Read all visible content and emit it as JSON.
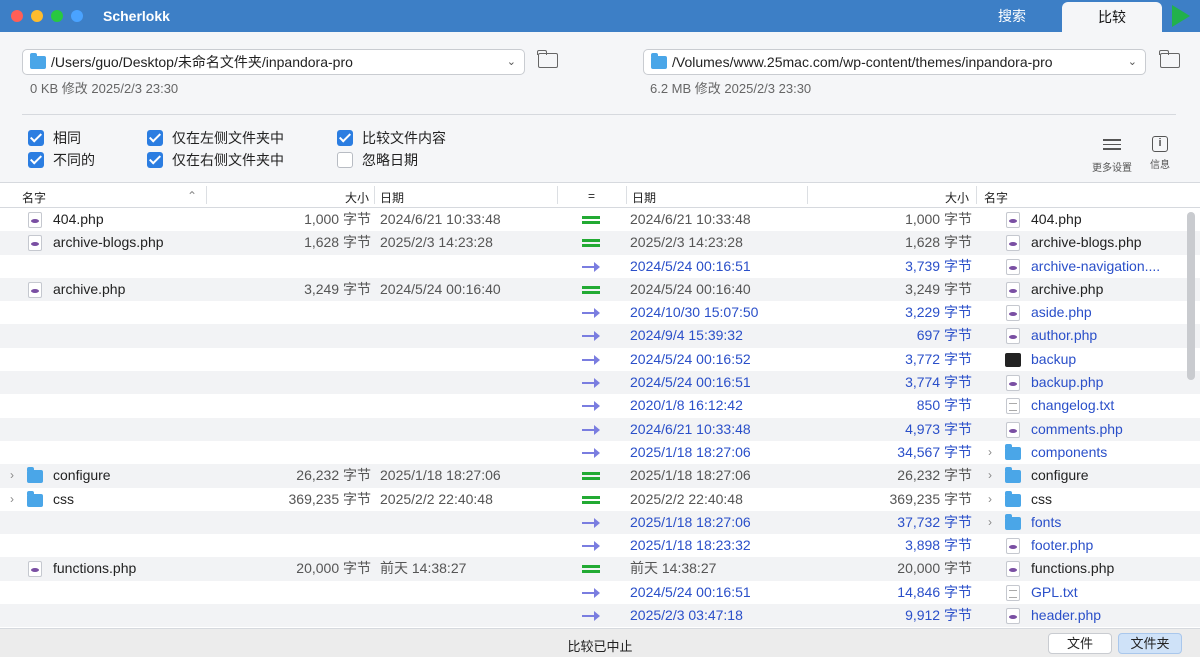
{
  "app_title": "Scherlokk",
  "tabs": [
    {
      "label": "搜索"
    },
    {
      "label": "比较"
    }
  ],
  "left": {
    "path": "/Users/guo/Desktop/未命名文件夹/inpandora-pro",
    "meta": "0 KB 修改 2025/2/3 23:30"
  },
  "right": {
    "path": "/Volumes/www.25mac.com/wp-content/themes/inpandora-pro",
    "meta": "6.2 MB 修改 2025/2/3 23:30"
  },
  "options": {
    "same": "相同",
    "different": "不同的",
    "only_left": "仅在左侧文件夹中",
    "only_right": "仅在右侧文件夹中",
    "compare_content": "比较文件内容",
    "ignore_date": "忽略日期"
  },
  "tools": {
    "more_settings": "更多设置",
    "info": "信息"
  },
  "columns": {
    "name": "名字",
    "size": "大小",
    "date": "日期",
    "compare": "="
  },
  "rows": [
    {
      "lname": "404.php",
      "lsize": "1,000 字节",
      "ldate": "2024/6/21 10:33:48",
      "rdate": "2024/6/21 10:33:48",
      "rsize": "1,000 字节",
      "rname": "404.php"
    },
    {
      "lname": "archive-blogs.php",
      "lsize": "1,628 字节",
      "ldate": "2025/2/3 14:23:28",
      "rdate": "2025/2/3 14:23:28",
      "rsize": "1,628 字节",
      "rname": "archive-blogs.php"
    },
    {
      "lname": "",
      "lsize": "",
      "ldate": "",
      "rdate": "2024/5/24 00:16:51",
      "rsize": "3,739 字节",
      "rname": "archive-navigation...."
    },
    {
      "lname": "archive.php",
      "lsize": "3,249 字节",
      "ldate": "2024/5/24 00:16:40",
      "rdate": "2024/5/24 00:16:40",
      "rsize": "3,249 字节",
      "rname": "archive.php"
    },
    {
      "lname": "",
      "lsize": "",
      "ldate": "",
      "rdate": "2024/10/30 15:07:50",
      "rsize": "3,229 字节",
      "rname": "aside.php"
    },
    {
      "lname": "",
      "lsize": "",
      "ldate": "",
      "rdate": "2024/9/4 15:39:32",
      "rsize": "697 字节",
      "rname": "author.php"
    },
    {
      "lname": "",
      "lsize": "",
      "ldate": "",
      "rdate": "2024/5/24 00:16:52",
      "rsize": "3,772 字节",
      "rname": "backup"
    },
    {
      "lname": "",
      "lsize": "",
      "ldate": "",
      "rdate": "2024/5/24 00:16:51",
      "rsize": "3,774 字节",
      "rname": "backup.php"
    },
    {
      "lname": "",
      "lsize": "",
      "ldate": "",
      "rdate": "2020/1/8 16:12:42",
      "rsize": "850 字节",
      "rname": "changelog.txt"
    },
    {
      "lname": "",
      "lsize": "",
      "ldate": "",
      "rdate": "2024/6/21 10:33:48",
      "rsize": "4,973 字节",
      "rname": "comments.php"
    },
    {
      "lname": "",
      "lsize": "",
      "ldate": "",
      "rdate": "2025/1/18 18:27:06",
      "rsize": "34,567 字节",
      "rname": "components"
    },
    {
      "lname": "configure",
      "lsize": "26,232 字节",
      "ldate": "2025/1/18 18:27:06",
      "rdate": "2025/1/18 18:27:06",
      "rsize": "26,232 字节",
      "rname": "configure"
    },
    {
      "lname": "css",
      "lsize": "369,235 字节",
      "ldate": "2025/2/2 22:40:48",
      "rdate": "2025/2/2 22:40:48",
      "rsize": "369,235 字节",
      "rname": "css"
    },
    {
      "lname": "",
      "lsize": "",
      "ldate": "",
      "rdate": "2025/1/18 18:27:06",
      "rsize": "37,732 字节",
      "rname": "fonts"
    },
    {
      "lname": "",
      "lsize": "",
      "ldate": "",
      "rdate": "2025/1/18 18:23:32",
      "rsize": "3,898 字节",
      "rname": "footer.php"
    },
    {
      "lname": "functions.php",
      "lsize": "20,000 字节",
      "ldate": "前天 14:38:27",
      "rdate": "前天 14:38:27",
      "rsize": "20,000 字节",
      "rname": "functions.php"
    },
    {
      "lname": "",
      "lsize": "",
      "ldate": "",
      "rdate": "2024/5/24 00:16:51",
      "rsize": "14,846 字节",
      "rname": "GPL.txt"
    },
    {
      "lname": "",
      "lsize": "",
      "ldate": "",
      "rdate": "2025/2/3 03:47:18",
      "rsize": "9,912 字节",
      "rname": "header.php"
    }
  ],
  "status": {
    "text": "比较已中止",
    "file_btn": "文件",
    "folder_btn": "文件夹"
  }
}
